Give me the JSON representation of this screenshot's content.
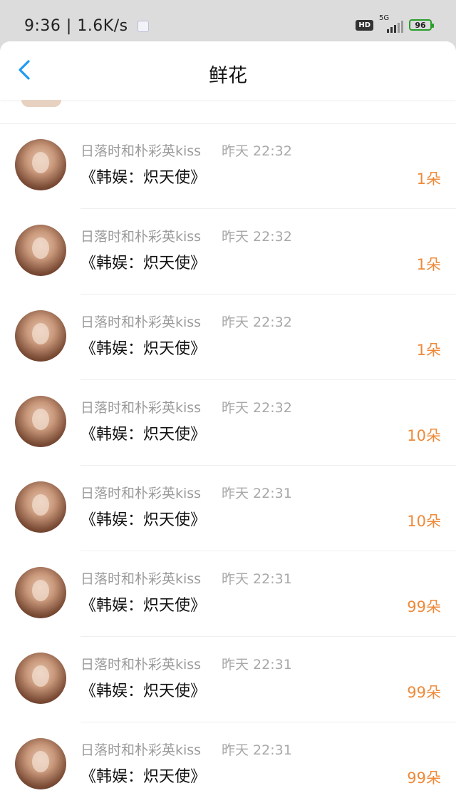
{
  "status_bar": {
    "time": "9:36",
    "net_speed": "1.6K/s",
    "hd_label": "HD",
    "network_label": "5G",
    "battery_level": "96"
  },
  "header": {
    "title": "鲜花",
    "back_icon": "chevron-left-icon"
  },
  "colors": {
    "back_icon": "#1e9bf0",
    "count_text": "#ee8a3a",
    "meta_text": "#9b9b9b"
  },
  "items": [
    {
      "name": "日落时和朴彩英kiss",
      "time": "昨天 22:32",
      "book": "《韩娱：炽天使》",
      "count": "1朵"
    },
    {
      "name": "日落时和朴彩英kiss",
      "time": "昨天 22:32",
      "book": "《韩娱：炽天使》",
      "count": "1朵"
    },
    {
      "name": "日落时和朴彩英kiss",
      "time": "昨天 22:32",
      "book": "《韩娱：炽天使》",
      "count": "1朵"
    },
    {
      "name": "日落时和朴彩英kiss",
      "time": "昨天 22:32",
      "book": "《韩娱：炽天使》",
      "count": "10朵"
    },
    {
      "name": "日落时和朴彩英kiss",
      "time": "昨天 22:31",
      "book": "《韩娱：炽天使》",
      "count": "10朵"
    },
    {
      "name": "日落时和朴彩英kiss",
      "time": "昨天 22:31",
      "book": "《韩娱：炽天使》",
      "count": "99朵"
    },
    {
      "name": "日落时和朴彩英kiss",
      "time": "昨天 22:31",
      "book": "《韩娱：炽天使》",
      "count": "99朵"
    },
    {
      "name": "日落时和朴彩英kiss",
      "time": "昨天 22:31",
      "book": "《韩娱：炽天使》",
      "count": "99朵"
    }
  ]
}
